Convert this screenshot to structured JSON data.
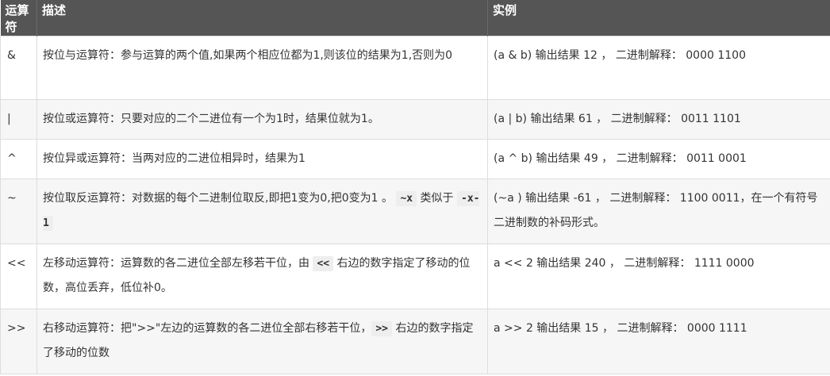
{
  "table": {
    "headers": {
      "operator": "运算符",
      "description": "描述",
      "example": "实例"
    },
    "rows": [
      {
        "op": "&",
        "desc": "按位与运算符：参与运算的两个值,如果两个相应位都为1,则该位的结果为1,否则为0",
        "example": "(a & b) 输出结果 12 ， 二进制解释： 0000 1100"
      },
      {
        "op": "|",
        "desc": "按位或运算符：只要对应的二个二进位有一个为1时，结果位就为1。",
        "example": "(a | b) 输出结果 61 ， 二进制解释： 0011 1101"
      },
      {
        "op": "^",
        "desc": "按位异或运算符：当两对应的二进位相异时，结果为1",
        "example": "(a ^ b) 输出结果 49 ， 二进制解释： 0011 0001"
      },
      {
        "op": "~",
        "desc_before": "按位取反运算符：对数据的每个二进制位取反,即把1变为0,把0变为1 。",
        "desc_code1": "~x",
        "desc_mid": " 类似于 ",
        "desc_code2": "-x-1",
        "example": "(~a ) 输出结果 -61 ， 二进制解释： 1100 0011，在一个有符号二进制数的补码形式。"
      },
      {
        "op": "<<",
        "desc_before": "左移动运算符：运算数的各二进位全部左移若干位，由 ",
        "desc_code1": "<<",
        "desc_after": " 右边的数字指定了移动的位数，高位丢弃，低位补0。",
        "example": "a << 2 输出结果 240 ， 二进制解释： 1111 0000"
      },
      {
        "op": ">>",
        "desc_before": "右移动运算符：把\">>\"左边的运算数的各二进位全部右移若干位，",
        "desc_code1": ">>",
        "desc_after": " 右边的数字指定了移动的位数",
        "example": "a >> 2 输出结果 15 ， 二进制解释： 0000 1111"
      }
    ]
  }
}
